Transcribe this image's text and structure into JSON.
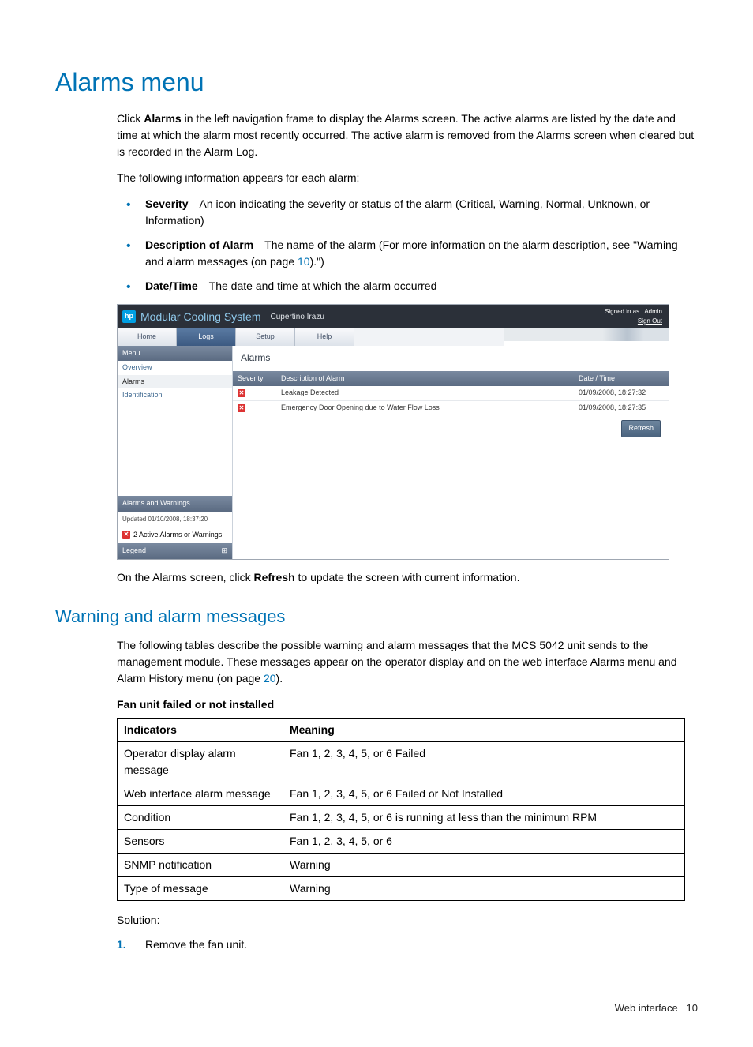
{
  "h1": "Alarms menu",
  "p1a": "Click ",
  "p1b": "Alarms",
  "p1c": " in the left navigation frame to display the Alarms screen. The active alarms are listed by the date and time at which the alarm most recently occurred. The active alarm is removed from the Alarms screen when cleared but is recorded in the Alarm Log.",
  "p2": "The following information appears for each alarm:",
  "bul1a": "Severity",
  "bul1b": "—An icon indicating the severity or status of the alarm (Critical, Warning, Normal, Unknown, or Information)",
  "bul2a": "Description of Alarm",
  "bul2b": "—The name of the alarm (For more information on the alarm description, see \"Warning and alarm messages (on page ",
  "bul2link": "10",
  "bul2c": ").\")",
  "bul3a": "Date/Time",
  "bul3b": "—The date and time at which the alarm occurred",
  "ss": {
    "logo": "hp",
    "title": "Modular Cooling System",
    "subtitle": "Cupertino Irazu",
    "signedin": "Signed in as : Admin",
    "signout": "Sign Out",
    "tabs": [
      "Home",
      "Logs",
      "Setup",
      "Help"
    ],
    "menu_head": "Menu",
    "menu_items": [
      "Overview",
      "Alarms",
      "Identification"
    ],
    "aw_head": "Alarms and Warnings",
    "aw_updated": "Updated 01/10/2008, 18:37:20",
    "aw_count": "2 Active Alarms or Warnings",
    "legend": "Legend",
    "legend_icon": "⊞",
    "main_title": "Alarms",
    "cols": [
      "Severity",
      "Description of Alarm",
      "Date / Time"
    ],
    "rows": [
      {
        "desc": "Leakage Detected",
        "dt": "01/09/2008, 18:27:32"
      },
      {
        "desc": "Emergency Door Opening due to Water Flow Loss",
        "dt": "01/09/2008, 18:27:35"
      }
    ],
    "refresh": "Refresh"
  },
  "p3a": "On the Alarms screen, click ",
  "p3b": "Refresh",
  "p3c": " to update the screen with current information.",
  "h2": "Warning and alarm messages",
  "p4a": "The following tables describe the possible warning and alarm messages that the MCS 5042 unit sends to the management module. These messages appear on the operator display and on the web interface Alarms menu and Alarm History menu (on page ",
  "p4link": "20",
  "p4b": ").",
  "tbl_title": "Fan unit failed or not installed",
  "tbl_h1": "Indicators",
  "tbl_h2": "Meaning",
  "tbl_rows": [
    {
      "k": "Operator display alarm message",
      "v": "Fan 1, 2, 3, 4, 5, or 6 Failed"
    },
    {
      "k": "Web interface alarm message",
      "v": "Fan 1, 2, 3, 4, 5, or 6 Failed or Not Installed"
    },
    {
      "k": "Condition",
      "v": "Fan 1, 2, 3, 4, 5, or 6 is running at less than the minimum RPM"
    },
    {
      "k": "Sensors",
      "v": "Fan 1, 2, 3, 4, 5, or 6"
    },
    {
      "k": "SNMP notification",
      "v": "Warning"
    },
    {
      "k": "Type of message",
      "v": "Warning"
    }
  ],
  "solution": "Solution:",
  "step1": "Remove the fan unit.",
  "footer_label": "Web interface",
  "footer_page": "10"
}
